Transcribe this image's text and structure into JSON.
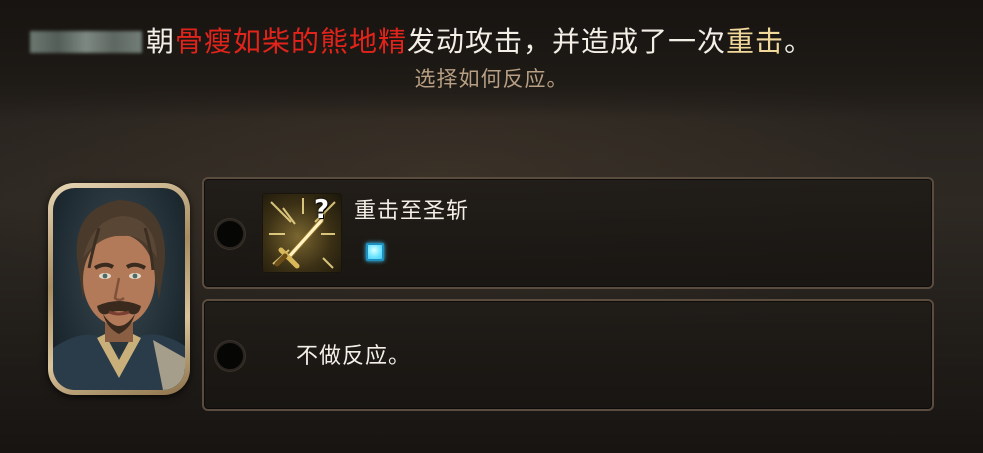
{
  "prompt": {
    "redacted_name": "",
    "part1": "朝",
    "enemy_name": "骨瘦如柴的熊地精",
    "part2": "发动攻击，并造成了一次",
    "hit_type": "重击",
    "part3": "。",
    "subtitle": "选择如何反应。"
  },
  "colors": {
    "enemy_name": "#e0241b",
    "hit_type": "#f0d79a",
    "subtitle": "#b89f84",
    "reaction_gem": "#6fe6ff"
  },
  "options": [
    {
      "label": "重击至圣斩",
      "icon": "sword-smite-icon",
      "badge": "?",
      "selected": false
    },
    {
      "label": "不做反应。",
      "selected": false
    }
  ],
  "portrait": {
    "icon": "character-portrait"
  }
}
